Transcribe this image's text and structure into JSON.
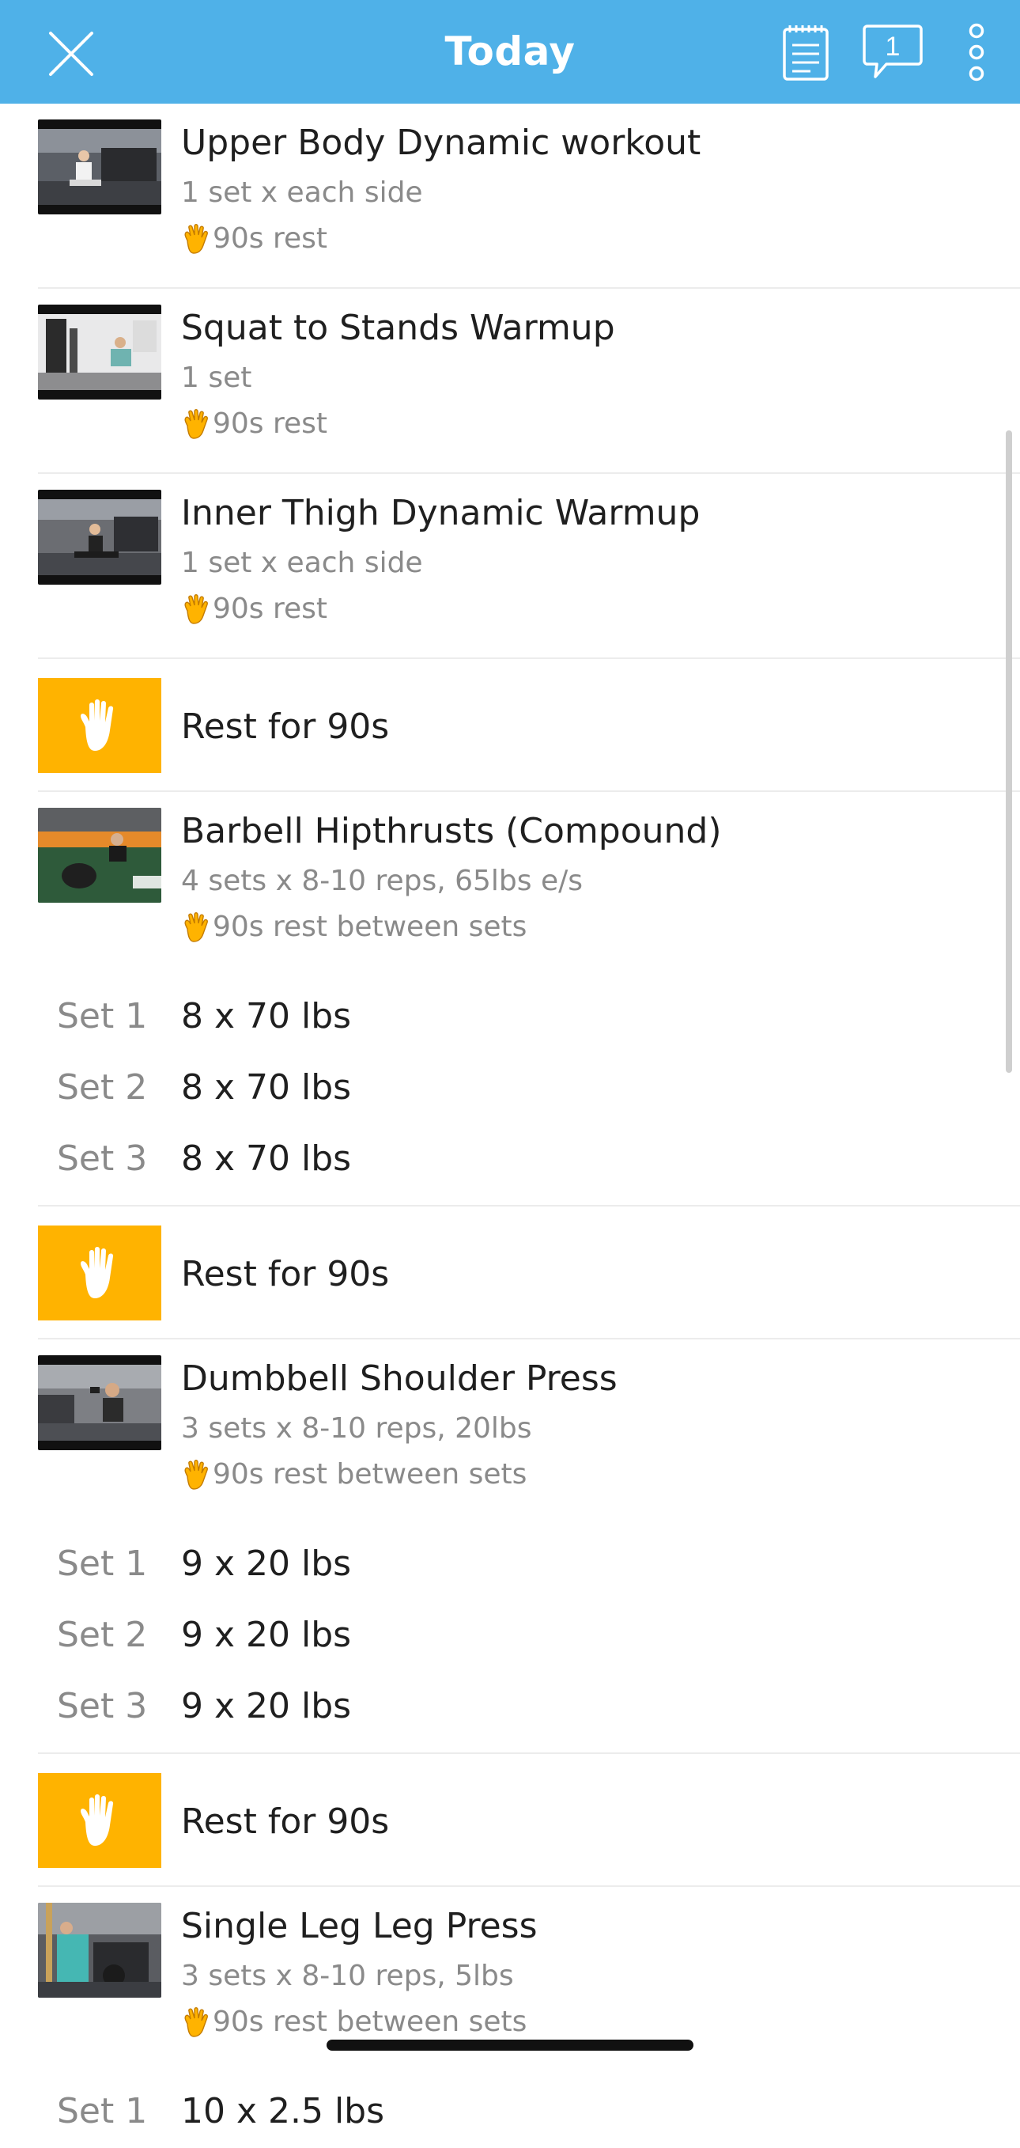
{
  "header": {
    "title": "Today",
    "chat_count": "1",
    "color": "#4fb1e8"
  },
  "rest_color": "#ffb300",
  "exercises_top": [
    {
      "name": "Upper Body Dynamic workout",
      "detail": "1 set x each side",
      "rest": "90s rest",
      "icon": "workout-video-thumbnail"
    },
    {
      "name": "Squat to Stands Warmup",
      "detail": "1 set",
      "rest": "90s rest",
      "icon": "workout-video-thumbnail"
    },
    {
      "name": "Inner Thigh Dynamic Warmup",
      "detail": "1 set x each side",
      "rest": "90s rest",
      "icon": "workout-video-thumbnail"
    }
  ],
  "rest_label": "Rest for 90s",
  "barbell": {
    "name": "Barbell Hipthrusts (Compound)",
    "detail": "4 sets x 8-10 reps, 65lbs e/s",
    "rest": "90s rest between sets",
    "sets": [
      {
        "label": "Set 1",
        "value": "8 x 70 lbs"
      },
      {
        "label": "Set 2",
        "value": "8 x 70 lbs"
      },
      {
        "label": "Set 3",
        "value": "8 x 70 lbs"
      }
    ]
  },
  "dumbbell": {
    "name": "Dumbbell Shoulder Press",
    "detail": "3 sets x 8-10 reps, 20lbs",
    "rest": "90s rest between sets",
    "sets": [
      {
        "label": "Set 1",
        "value": "9 x 20 lbs"
      },
      {
        "label": "Set 2",
        "value": "9 x 20 lbs"
      },
      {
        "label": "Set 3",
        "value": "9 x 20 lbs"
      }
    ]
  },
  "legpress": {
    "name": "Single Leg Leg Press",
    "detail": "3 sets x 8-10 reps, 5lbs",
    "rest": "90s rest between sets",
    "sets": [
      {
        "label": "Set 1",
        "value": "10 x 2.5 lbs"
      }
    ]
  }
}
